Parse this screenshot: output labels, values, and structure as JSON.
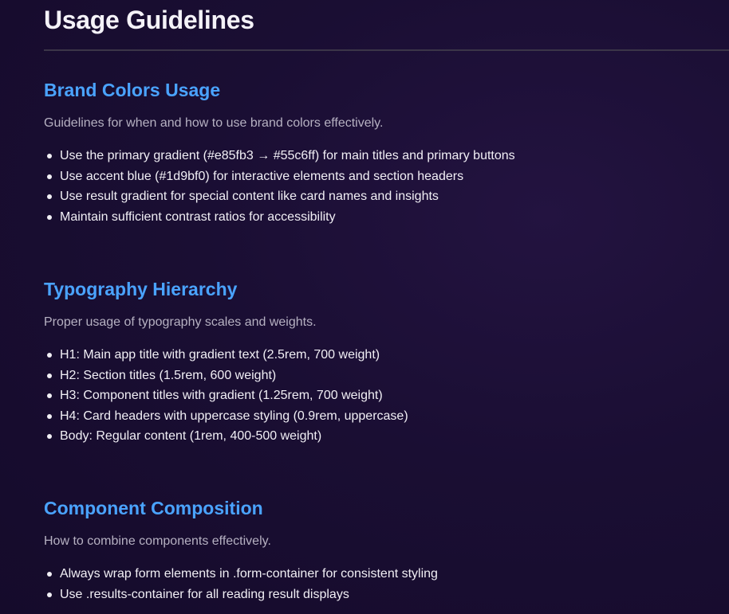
{
  "page": {
    "title": "Usage Guidelines"
  },
  "sections": [
    {
      "heading": "Brand Colors Usage",
      "description": "Guidelines for when and how to use brand colors effectively.",
      "items": [
        "Use the primary gradient (#e85fb3 → #55c6ff) for main titles and primary buttons",
        "Use accent blue (#1d9bf0) for interactive elements and section headers",
        "Use result gradient for special content like card names and insights",
        "Maintain sufficient contrast ratios for accessibility"
      ]
    },
    {
      "heading": "Typography Hierarchy",
      "description": "Proper usage of typography scales and weights.",
      "items": [
        "H1: Main app title with gradient text (2.5rem, 700 weight)",
        "H2: Section titles (1.5rem, 600 weight)",
        "H3: Component titles with gradient (1.25rem, 700 weight)",
        "H4: Card headers with uppercase styling (0.9rem, uppercase)",
        "Body: Regular content (1rem, 400-500 weight)"
      ]
    },
    {
      "heading": "Component Composition",
      "description": "How to combine components effectively.",
      "items": [
        "Always wrap form elements in .form-container for consistent styling",
        "Use .results-container for all reading result displays"
      ]
    }
  ],
  "colors": {
    "background": "#1a0e33",
    "heading_accent": "#4aa3ff",
    "body_text": "#f1eff5",
    "muted_text": "#b6b1c2"
  }
}
